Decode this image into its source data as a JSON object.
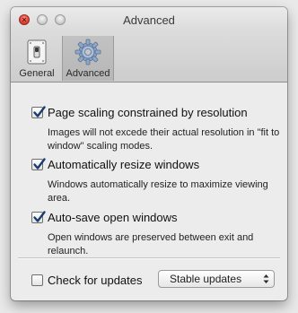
{
  "window": {
    "title": "Advanced",
    "close_glyph": "×"
  },
  "toolbar": {
    "tabs": [
      {
        "label": "General",
        "icon": "general-switch-icon",
        "selected": false
      },
      {
        "label": "Advanced",
        "icon": "gear-icon",
        "selected": true
      }
    ]
  },
  "options": [
    {
      "label": "Page scaling constrained by resolution",
      "description": "Images will not excede their actual resolution in \"fit to window\" scaling modes.",
      "checked": true
    },
    {
      "label": "Automatically resize windows",
      "description": "Windows automatically resize to maximize viewing area.",
      "checked": true
    },
    {
      "label": "Auto-save open windows",
      "description": "Open windows are preserved between exit and relaunch.",
      "checked": true
    }
  ],
  "updates": {
    "check_label": "Check for updates",
    "checked": false,
    "channel_selected": "Stable updates"
  },
  "colors": {
    "checkmark": "#1a3c6e",
    "accent": "#3b75c8"
  }
}
